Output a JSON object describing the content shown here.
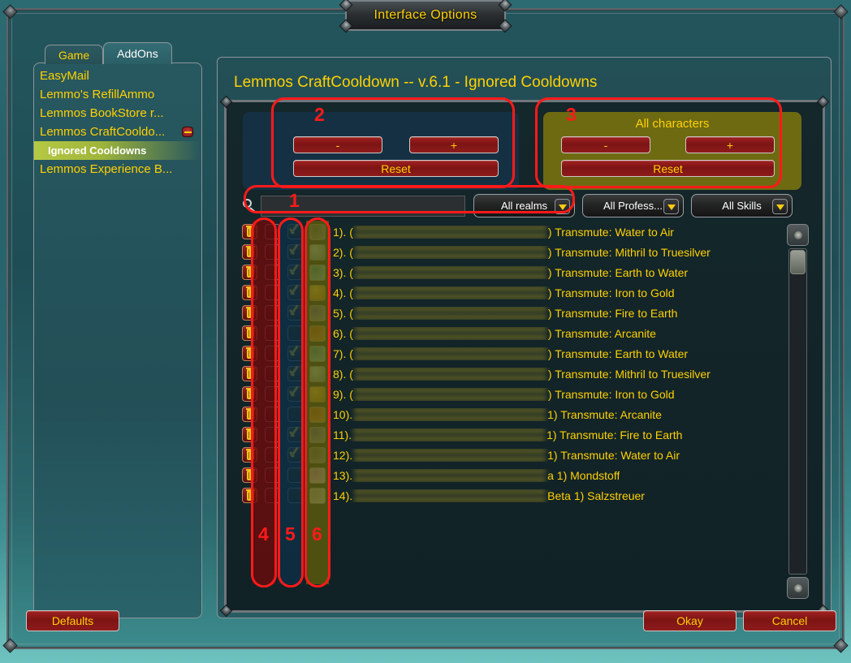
{
  "window": {
    "title": "Interface Options"
  },
  "tabs": [
    {
      "label": "Game",
      "active": false
    },
    {
      "label": "AddOns",
      "active": true
    }
  ],
  "sidebar": {
    "items": [
      {
        "label": "EasyMail",
        "child": false,
        "selected": false,
        "collapse": false
      },
      {
        "label": "Lemmo's RefillAmmo",
        "child": false,
        "selected": false,
        "collapse": false
      },
      {
        "label": "Lemmos BookStore r...",
        "child": false,
        "selected": false,
        "collapse": false
      },
      {
        "label": "Lemmos CraftCooldo...",
        "child": false,
        "selected": false,
        "collapse": true
      },
      {
        "label": "Ignored Cooldowns",
        "child": true,
        "selected": true,
        "collapse": false
      },
      {
        "label": "Lemmos Experience B...",
        "child": false,
        "selected": false,
        "collapse": false
      }
    ]
  },
  "panel": {
    "title": "Lemmos CraftCooldown -- v.6.1 - Ignored Cooldowns"
  },
  "group_character": {
    "title": "",
    "minus_label": "-",
    "plus_label": "+",
    "reset_label": "Reset"
  },
  "group_all_characters": {
    "title": "All characters",
    "minus_label": "-",
    "plus_label": "+",
    "reset_label": "Reset"
  },
  "search": {
    "value": "",
    "placeholder": "",
    "icon": "search-icon"
  },
  "dropdowns": [
    {
      "label": "All realms"
    },
    {
      "label": "All Profess..."
    },
    {
      "label": "All Skills"
    }
  ],
  "list": {
    "rows": [
      {
        "num": "1).",
        "pre": "(",
        "post": ") Transmute: Water to Air",
        "delete": true,
        "select": false,
        "ignore": true,
        "icon_colors": [
          "#4a5158",
          "#8c97a3"
        ]
      },
      {
        "num": "2).",
        "pre": "(",
        "post": ") Transmute: Mithril to Truesilver",
        "delete": true,
        "select": false,
        "ignore": true,
        "icon_colors": [
          "#bfe4ee",
          "#5c8ea0"
        ]
      },
      {
        "num": "3).",
        "pre": "(",
        "post": ") Transmute: Earth to Water",
        "delete": true,
        "select": false,
        "ignore": true,
        "icon_colors": [
          "#2e8fa8",
          "#8fd5e4"
        ]
      },
      {
        "num": "4).",
        "pre": "(",
        "post": ") Transmute: Iron to Gold",
        "delete": true,
        "select": false,
        "ignore": true,
        "icon_colors": [
          "#ffd24a",
          "#c07a12"
        ]
      },
      {
        "num": "5).",
        "pre": "(",
        "post": ") Transmute: Fire to Earth",
        "delete": true,
        "select": false,
        "ignore": true,
        "icon_colors": [
          "#4a4f9e",
          "#9aa0b4"
        ]
      },
      {
        "num": "6).",
        "pre": "(",
        "post": ") Transmute: Arcanite",
        "delete": true,
        "select": false,
        "ignore": false,
        "icon_colors": [
          "#b54a1e",
          "#e7903f"
        ]
      },
      {
        "num": "7).",
        "pre": "(",
        "post": " ) Transmute: Earth to Water",
        "delete": true,
        "select": false,
        "ignore": true,
        "icon_colors": [
          "#2e8fa8",
          "#8fd5e4"
        ]
      },
      {
        "num": "8).",
        "pre": "(",
        "post": " ) Transmute: Mithril to Truesilver",
        "delete": true,
        "select": false,
        "ignore": true,
        "icon_colors": [
          "#bfe4ee",
          "#5c8ea0"
        ]
      },
      {
        "num": "9).",
        "pre": "(",
        "post": ") Transmute: Iron to Gold",
        "delete": true,
        "select": false,
        "ignore": true,
        "icon_colors": [
          "#ffd24a",
          "#c07a12"
        ]
      },
      {
        "num": "10).",
        "pre": "",
        "post": "1) Transmute: Arcanite",
        "delete": true,
        "select": false,
        "ignore": false,
        "icon_colors": [
          "#b54a1e",
          "#e7903f"
        ]
      },
      {
        "num": "11).",
        "pre": "",
        "post": "1) Transmute: Fire to Earth",
        "delete": true,
        "select": false,
        "ignore": true,
        "icon_colors": [
          "#4a4f9e",
          "#9aa0b4"
        ]
      },
      {
        "num": "12).",
        "pre": "",
        "post": "1) Transmute: Water to Air",
        "delete": true,
        "select": false,
        "ignore": true,
        "icon_colors": [
          "#4a5158",
          "#8c97a3"
        ]
      },
      {
        "num": "13).",
        "pre": "",
        "post": "a 1) Mondstoff",
        "delete": true,
        "select": false,
        "ignore": false,
        "icon_colors": [
          "#c47ae0",
          "#efd7f7"
        ]
      },
      {
        "num": "14).",
        "pre": "",
        "post": "Beta 1) Salzstreuer",
        "delete": true,
        "select": false,
        "ignore": false,
        "icon_colors": [
          "#9aa6ad",
          "#d6dde1"
        ]
      }
    ]
  },
  "scrollbar": {
    "up": "scroll-up-icon",
    "down": "scroll-down-icon"
  },
  "footer": {
    "defaults_label": "Defaults",
    "okay_label": "Okay",
    "cancel_label": "Cancel"
  },
  "annotations": [
    {
      "id": "1",
      "target": "search-field"
    },
    {
      "id": "2",
      "target": "character-group"
    },
    {
      "id": "3",
      "target": "all-characters-group"
    },
    {
      "id": "4",
      "target": "delete-column"
    },
    {
      "id": "5",
      "target": "select-column"
    },
    {
      "id": "6",
      "target": "ignore-column"
    }
  ],
  "colors": {
    "accent": "#ffd100",
    "annotation": "#ff1a1a",
    "button_red": "#a32121",
    "selected_green": "#b5c943"
  }
}
